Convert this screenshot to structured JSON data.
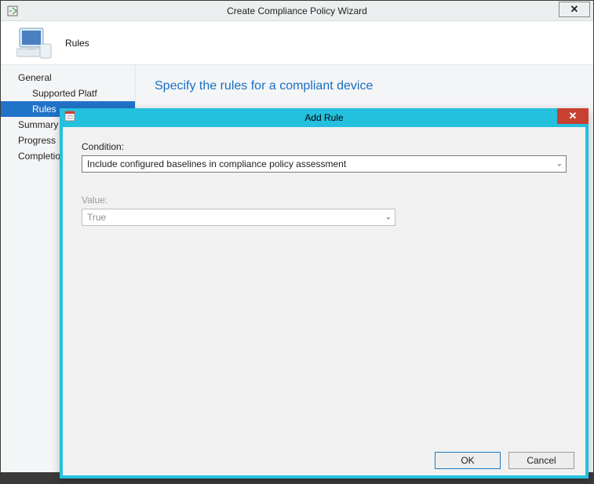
{
  "wizard": {
    "title": "Create Compliance Policy Wizard",
    "header_title": "Rules",
    "main_heading": "Specify the rules for a compliant device",
    "sidebar": [
      {
        "label": "General",
        "indent": false,
        "selected": false
      },
      {
        "label": "Supported Platf",
        "indent": true,
        "selected": false
      },
      {
        "label": "Rules",
        "indent": true,
        "selected": true
      },
      {
        "label": "Summary",
        "indent": false,
        "selected": false
      },
      {
        "label": "Progress",
        "indent": false,
        "selected": false
      },
      {
        "label": "Completion",
        "indent": false,
        "selected": false
      }
    ]
  },
  "modal": {
    "title": "Add Rule",
    "condition_label": "Condition:",
    "condition_value": "Include configured baselines in compliance policy assessment",
    "value_label": "Value:",
    "value_value": "True",
    "ok_label": "OK",
    "cancel_label": "Cancel"
  }
}
